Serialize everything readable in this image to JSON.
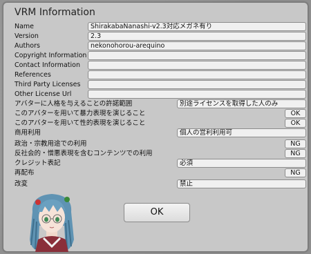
{
  "dialog": {
    "title": "VRM Information"
  },
  "meta": {
    "name_label": "Name",
    "name_value": "ShirakabaNanashi-v2.3対応メガネ有り",
    "version_label": "Version",
    "version_value": "2.3",
    "authors_label": "Authors",
    "authors_value": "nekonohorou-arequino",
    "copyright_label": "Copyright Information",
    "copyright_value": "",
    "contact_label": "Contact Information",
    "contact_value": "",
    "references_label": "References",
    "references_value": "",
    "third_party_label": "Third Party Licenses",
    "third_party_value": "",
    "other_license_label": "Other License Url",
    "other_license_value": ""
  },
  "permissions": {
    "allowed_user_label": "アバターに人格を与えることの許諾範囲",
    "allowed_user_value": "別途ライセンスを取得した人のみ",
    "violent_label": "このアバターを用いて暴力表現を演じること",
    "violent_value": "OK",
    "sexual_label": "このアバターを用いて性的表現を演じること",
    "sexual_value": "OK",
    "commercial_label": "商用利用",
    "commercial_value": "個人の営利利用可",
    "political_label": "政治・宗教用途での利用",
    "political_value": "NG",
    "antisocial_label": "反社会的・憎悪表現を含むコンテンツでの利用",
    "antisocial_value": "NG",
    "credit_label": "クレジット表記",
    "credit_value": "必須",
    "redistribution_label": "再配布",
    "redistribution_value": "NG",
    "modification_label": "改変",
    "modification_value": "禁止"
  },
  "actions": {
    "ok_label": "OK"
  },
  "thumbnail": {
    "icon": "avatar-thumbnail"
  }
}
